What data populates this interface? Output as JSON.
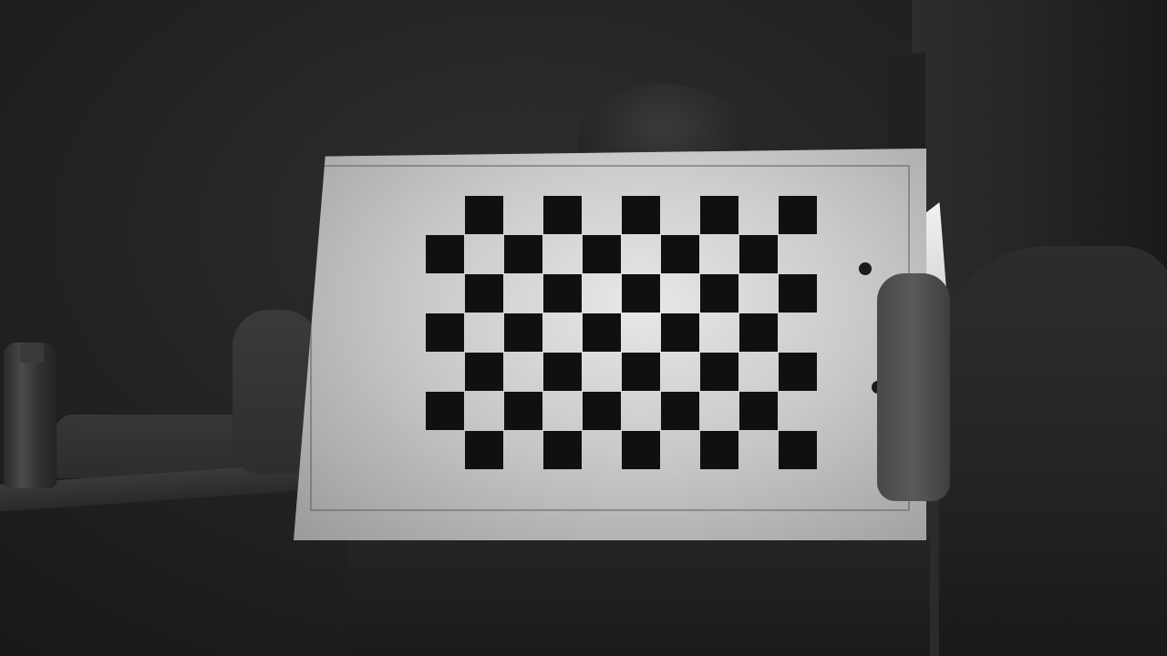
{
  "scene": {
    "description_kind": "photo",
    "subject": "person-holding-checkerboard",
    "checkerboard": {
      "columns": 10,
      "rows": 7,
      "dark_color": "#101010",
      "light_color": "#d8d8d8"
    },
    "image_tone": "grayscale"
  }
}
